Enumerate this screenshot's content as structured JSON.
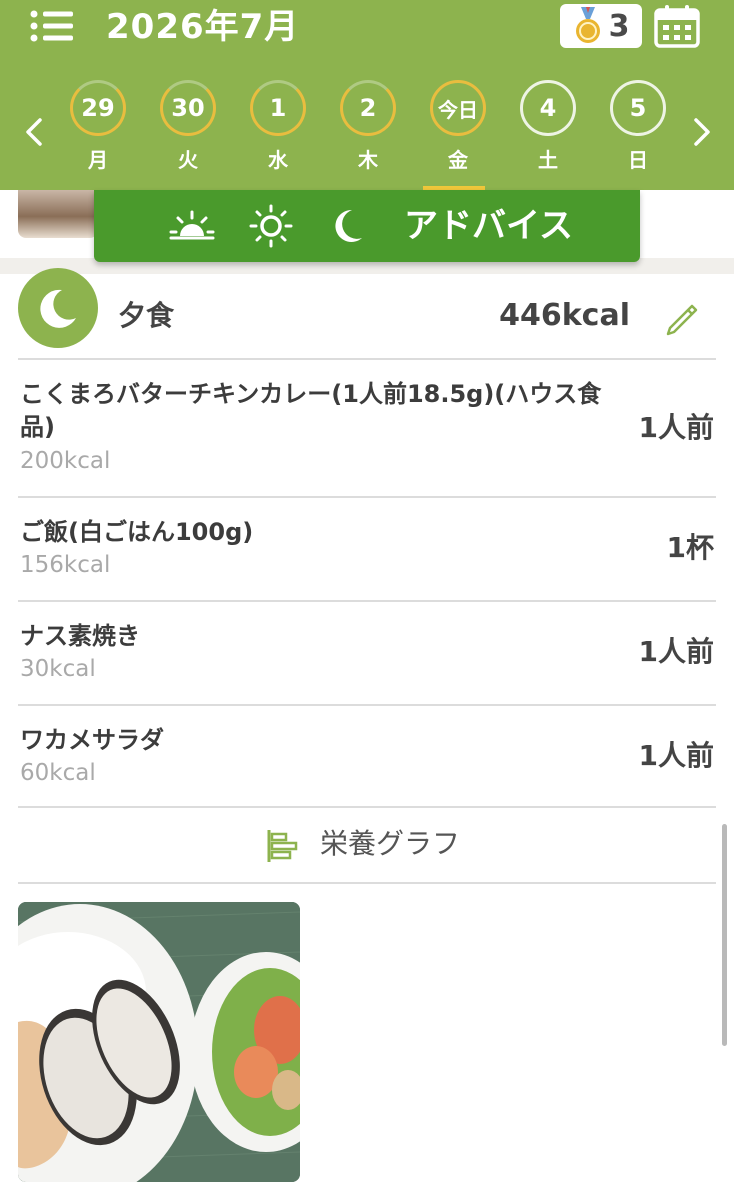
{
  "colors": {
    "accent": "#8db34e",
    "advice_bar": "#4a9a2c",
    "highlight": "#e9bd3f",
    "muted_text": "#a9a9a9"
  },
  "header": {
    "title": "2026年7月",
    "menu_icon": "list-menu-icon",
    "medal_icon": "medal-icon",
    "medal_count": "3",
    "calendar_icon": "calendar-icon",
    "days": [
      {
        "num": "29",
        "label": "月",
        "state": "partial"
      },
      {
        "num": "30",
        "label": "火",
        "state": "partial"
      },
      {
        "num": "1",
        "label": "水",
        "state": "partial"
      },
      {
        "num": "2",
        "label": "木",
        "state": "partial"
      },
      {
        "num": "今日",
        "label": "金",
        "state": "today"
      },
      {
        "num": "4",
        "label": "土",
        "state": "empty"
      },
      {
        "num": "5",
        "label": "日",
        "state": "empty"
      }
    ]
  },
  "advice_bar": {
    "icons": [
      "sunrise-icon",
      "sun-icon",
      "moon-icon"
    ],
    "label": "アドバイス"
  },
  "meal": {
    "title": "夕食",
    "total_kcal": "446kcal",
    "icon": "moon-icon",
    "items": [
      {
        "name": "こくまろバターチキンカレー(1人前18.5g)(ハウス食品)",
        "kcal": "200kcal",
        "qty": "1人前"
      },
      {
        "name": "ご飯(白ごはん100g)",
        "kcal": "156kcal",
        "qty": "1杯"
      },
      {
        "name": "ナス素焼き",
        "kcal": "30kcal",
        "qty": "1人前"
      },
      {
        "name": "ワカメサラダ",
        "kcal": "60kcal",
        "qty": "1人前"
      }
    ]
  },
  "nutrition_graph": {
    "label": "栄養グラフ",
    "icon": "bar-chart-icon"
  }
}
